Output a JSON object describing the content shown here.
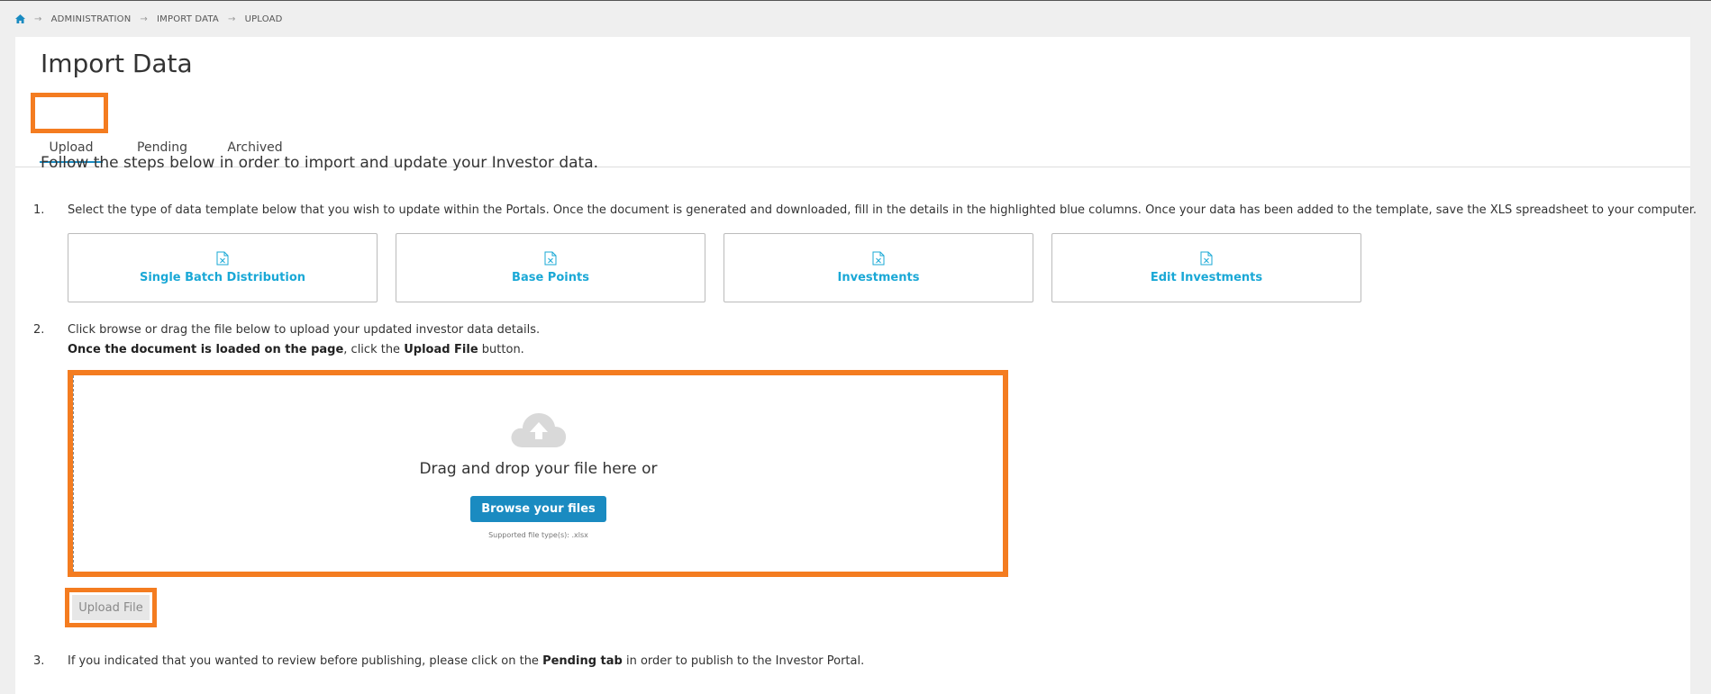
{
  "breadcrumb": {
    "home_icon": "home-icon",
    "items": [
      "ADMINISTRATION",
      "IMPORT DATA",
      "UPLOAD"
    ]
  },
  "page_title": "Import Data",
  "tabs": [
    {
      "label": "Upload",
      "active": true
    },
    {
      "label": "Pending",
      "active": false
    },
    {
      "label": "Archived",
      "active": false
    }
  ],
  "intro": "Follow the steps below in order to import and update your Investor data.",
  "steps": {
    "one": {
      "num": "1.",
      "text": "Select the type of data template below that you wish to update within the Portals. Once the document is generated and downloaded, fill in the details in the highlighted blue columns. Once your data has been added to the template, save the XLS spreadsheet to your computer."
    },
    "two": {
      "num": "2.",
      "line1": "Click browse or drag the file below to upload your updated investor data details.",
      "line2_bold": "Once the document is loaded on the page",
      "line2_mid": ", click the ",
      "line2_bold2": "Upload File",
      "line2_end": " button."
    },
    "three": {
      "num": "3.",
      "pre": "If you indicated that you wanted to review before publishing, please click on the ",
      "bold": "Pending tab",
      "post": " in order to publish to the Investor Portal."
    }
  },
  "templates": [
    {
      "label": "Single Batch Distribution",
      "icon": "excel-file-icon"
    },
    {
      "label": "Base Points",
      "icon": "excel-file-icon"
    },
    {
      "label": "Investments",
      "icon": "excel-file-icon"
    },
    {
      "label": "Edit Investments",
      "icon": "excel-file-icon"
    }
  ],
  "dropzone": {
    "icon": "cloud-upload-icon",
    "text": "Drag and drop your file here or",
    "browse_label": "Browse your files",
    "supported": "Supported file type(s): .xlsx"
  },
  "upload_button": "Upload File",
  "colors": {
    "accent": "#1a8bc1",
    "link": "#1aa8d6",
    "highlight": "#f47c20"
  }
}
